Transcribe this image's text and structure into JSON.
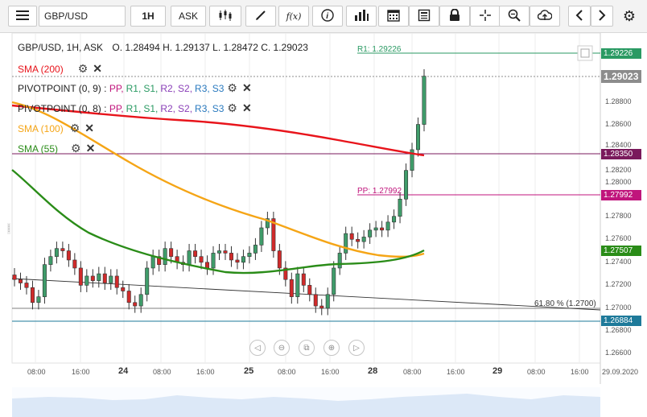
{
  "toolbar": {
    "symbol": "GBP/USD",
    "timeframe": "1H",
    "price_type": "ASK",
    "fx_label": "f(x)"
  },
  "header": {
    "symbol_line": "GBP/USD, 1H, ASK",
    "ohlc": "O. 1.28494  H. 1.29137  L. 1.28472  C. 1.29023"
  },
  "indicators": [
    {
      "label": "SMA (200)",
      "color": "#e8141b"
    },
    {
      "label": "PIVOTPOINT (0, 9)",
      "color": "#222222"
    },
    {
      "label": "PIVOTPOINT (0, 8)",
      "color": "#222222"
    },
    {
      "label": "SMA (100)",
      "color": "#f5a516"
    },
    {
      "label": "SMA (55)",
      "color": "#2a8c18"
    }
  ],
  "pivot_labels": {
    "sep": " : ",
    "pp": "PP,",
    "r1": "R1,",
    "s1": "S1,",
    "r2": "R2,",
    "s2": "S2,",
    "r3": "R3,",
    "s3": "S3",
    "pp_color": "#c0157c",
    "r1_color": "#2a9a63",
    "s1_color": "#2a9a63",
    "r2_color": "#8a3fb8",
    "s2_color": "#8a3fb8",
    "r3_color": "#2a7abf",
    "s3_color": "#2a7abf"
  },
  "annotations": {
    "r1": "R1: 1.29226",
    "pp": "PP: 1.27992",
    "fib": "61.80 % (1.2700)"
  },
  "price_tags": [
    {
      "text": "1.29226",
      "color": "#2a9a63",
      "value": 1.29226
    },
    {
      "text": "1.29023",
      "color": "#8c8c8c",
      "value": 1.29023
    },
    {
      "text": "1.28350",
      "color": "#7a1a5c",
      "value": 1.2835
    },
    {
      "text": "1.27992",
      "color": "#c0157c",
      "value": 1.27992
    },
    {
      "text": "1.27507",
      "color": "#2a8c18",
      "value": 1.27507
    },
    {
      "text": "1.26884",
      "color": "#1e7a9a",
      "value": 1.26884
    }
  ],
  "y_ticks": [
    "1.28800",
    "1.28600",
    "1.28400",
    "1.28200",
    "1.28000",
    "1.27800",
    "1.27600",
    "1.27400",
    "1.27200",
    "1.27000",
    "1.26800",
    "1.26600"
  ],
  "x_labels": [
    "08:00",
    "16:00",
    "24",
    "08:00",
    "16:00",
    "25",
    "08:00",
    "16:00",
    "28",
    "08:00",
    "16:00",
    "29",
    "08:00",
    "16:00",
    "29.09.2020"
  ],
  "chart_data": {
    "type": "candlestick",
    "symbol": "GBP/USD",
    "candles_close": [
      1.2725,
      1.2722,
      1.2718,
      1.2705,
      1.271,
      1.2738,
      1.2745,
      1.2752,
      1.275,
      1.2742,
      1.2735,
      1.272,
      1.2728,
      1.2724,
      1.273,
      1.2722,
      1.2728,
      1.2718,
      1.2715,
      1.2705,
      1.2702,
      1.2712,
      1.2735,
      1.2745,
      1.2738,
      1.2752,
      1.2745,
      1.274,
      1.2738,
      1.275,
      1.2745,
      1.274,
      1.2735,
      1.2748,
      1.275,
      1.2748,
      1.2742,
      1.274,
      1.2745,
      1.2748,
      1.2755,
      1.277,
      1.2778,
      1.275,
      1.2735,
      1.2725,
      1.271,
      1.273,
      1.272,
      1.2712,
      1.2702,
      1.27,
      1.2712,
      1.2735,
      1.2748,
      1.2765,
      1.276,
      1.2758,
      1.2762,
      1.2768,
      1.277,
      1.2768,
      1.2775,
      1.278,
      1.2795,
      1.282,
      1.2838,
      1.286,
      1.2902
    ],
    "sma200": [
      1.2878,
      1.2875,
      1.287,
      1.2865,
      1.2858,
      1.285,
      1.2838,
      1.2835
    ],
    "sma100": [
      1.285,
      1.281,
      1.2775,
      1.2755,
      1.2745,
      1.2742,
      1.2745
    ],
    "sma55": [
      1.2825,
      1.2768,
      1.2745,
      1.2738,
      1.274,
      1.2745,
      1.2751
    ],
    "levels": {
      "R1": 1.29226,
      "last": 1.29023,
      "S": 1.2835,
      "PP": 1.27992,
      "fib_61_8": 1.27,
      "S1": 1.26884
    }
  }
}
